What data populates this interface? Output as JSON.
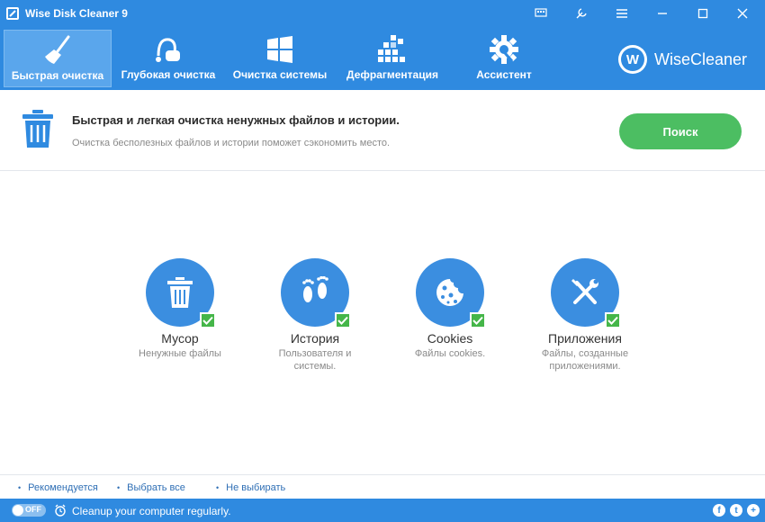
{
  "window": {
    "title": "Wise Disk Cleaner 9",
    "controls": [
      "chat-icon",
      "skin-icon",
      "menu-icon",
      "minimize-icon",
      "maximize-icon",
      "close-icon"
    ]
  },
  "toolbar": {
    "items": [
      {
        "label": "Быстрая очистка",
        "icon": "broom-icon",
        "active": true
      },
      {
        "label": "Глубокая очистка",
        "icon": "vacuum-icon",
        "active": false
      },
      {
        "label": "Очистка системы",
        "icon": "windows-icon",
        "active": false
      },
      {
        "label": "Дефрагментация",
        "icon": "defrag-icon",
        "active": false
      },
      {
        "label": "Ассистент",
        "icon": "gear-icon",
        "active": false
      }
    ],
    "brand": {
      "logo_letter": "W",
      "name": "WiseCleaner"
    }
  },
  "header": {
    "title": "Быстрая и легкая очистка ненужных файлов и истории.",
    "subtitle": "Очистка бесполезных файлов и истории поможет сэкономить место.",
    "search_label": "Поиск"
  },
  "categories": [
    {
      "name": "Мусор",
      "desc": "Ненужные файлы",
      "icon": "trash-icon",
      "checked": true
    },
    {
      "name": "История",
      "desc": "Пользователя и системы.",
      "icon": "footprints-icon",
      "checked": true
    },
    {
      "name": "Cookies",
      "desc": "Файлы cookies.",
      "icon": "cookie-icon",
      "checked": true
    },
    {
      "name": "Приложения",
      "desc": "Файлы, созданные приложениями.",
      "icon": "tools-icon",
      "checked": true
    }
  ],
  "bottom_links": {
    "recommended": "Рекомендуется",
    "select_all": "Выбрать все",
    "select_none": "Не выбирать"
  },
  "status": {
    "toggle_label": "OFF",
    "text": "Cleanup your computer regularly.",
    "social": [
      "f",
      "t",
      "+"
    ]
  },
  "colors": {
    "accent": "#2f8ae0",
    "search_button": "#4cbe62",
    "check": "#45b649",
    "category_circle": "#3b8ee0"
  }
}
